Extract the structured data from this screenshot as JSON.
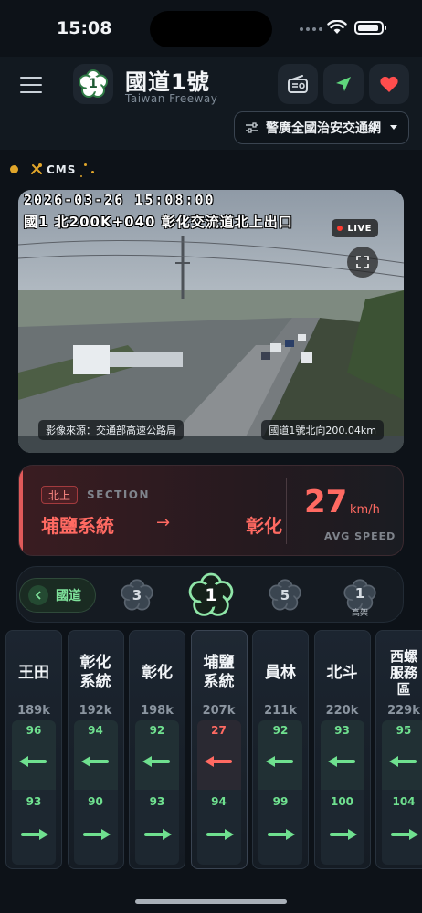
{
  "status_bar": {
    "time": "15:08"
  },
  "header": {
    "logo_number": "1",
    "title": "國道1號",
    "subtitle": "Taiwan Freeway",
    "network_select": "警廣全國治安交通網"
  },
  "cms": {
    "label": "CMS"
  },
  "camera": {
    "timestamp": "2026-03-26 15:08:00",
    "location_overlay": "國1 北200K+040 彰化交流道北上出口",
    "live_label": "LIVE",
    "source": "影像來源：交通部高速公路局",
    "position": "國道1號北向200.04km"
  },
  "section": {
    "direction": "北上",
    "section_label": "SECTION",
    "from": "埔鹽系統",
    "arrow": "→",
    "to": "彰化",
    "avg_speed": "27",
    "unit": "km/h",
    "avg_speed_label": "AVG SPEED"
  },
  "routes": {
    "back_label": "國道",
    "items": [
      {
        "num": "3",
        "sub": "",
        "active": false
      },
      {
        "num": "1",
        "sub": "",
        "active": true
      },
      {
        "num": "5",
        "sub": "",
        "active": false
      },
      {
        "num": "1",
        "sub": "高架",
        "active": false
      }
    ]
  },
  "stations": [
    {
      "name": "王田",
      "km": "189k",
      "north": "96",
      "south": "93",
      "north_slow": false
    },
    {
      "name": "彰化系統",
      "km": "192k",
      "north": "94",
      "south": "90",
      "north_slow": false
    },
    {
      "name": "彰化",
      "km": "198k",
      "north": "92",
      "south": "93",
      "north_slow": false
    },
    {
      "name": "埔鹽系統",
      "km": "207k",
      "north": "27",
      "south": "94",
      "north_slow": true
    },
    {
      "name": "員林",
      "km": "211k",
      "north": "92",
      "south": "99",
      "north_slow": false
    },
    {
      "name": "北斗",
      "km": "220k",
      "north": "93",
      "south": "100",
      "north_slow": false
    },
    {
      "name": "西螺服務區",
      "km": "229k",
      "north": "95",
      "south": "104",
      "north_slow": false
    }
  ],
  "colors": {
    "fast": "#6fe08f",
    "slow": "#ff6a62",
    "accent_red": "#e05a5a",
    "green_button": "#7fe39b"
  },
  "icons": {
    "menu": "hamburger-icon",
    "radio": "radio-icon",
    "locate": "navigation-arrow-icon",
    "favorite": "heart-icon",
    "filter": "sliders-icon",
    "cms": "tools-icon",
    "fullscreen": "expand-icon"
  }
}
